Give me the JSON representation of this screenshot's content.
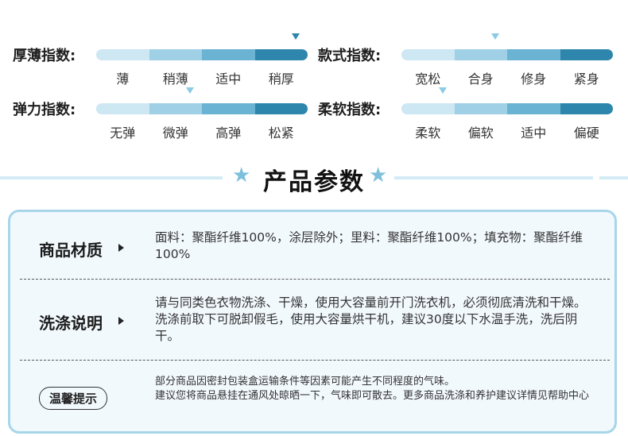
{
  "indices": {
    "thickness": {
      "label": "厚薄指数:",
      "options": [
        "薄",
        "稍薄",
        "适中",
        "稍厚"
      ],
      "selected_index": 3
    },
    "style": {
      "label": "款式指数:",
      "options": [
        "宽松",
        "合身",
        "修身",
        "紧身"
      ],
      "selected_index": 1
    },
    "elasticity": {
      "label": "弹力指数:",
      "options": [
        "无弹",
        "微弹",
        "高弹",
        "松紧"
      ],
      "selected_index": 1
    },
    "softness": {
      "label": "柔软指数:",
      "options": [
        "柔软",
        "偏软",
        "适中",
        "偏硬"
      ],
      "selected_index": 0
    }
  },
  "section": {
    "title": "产品参数",
    "star_glyph": "★"
  },
  "params": {
    "material": {
      "title": "商品材质",
      "text": "面料：聚酯纤维100%，涂层除外；里料：聚酯纤维100%；填充物：聚酯纤维100%"
    },
    "washing": {
      "title": "洗涤说明",
      "text": "请与同类色衣物洗涤、干燥，使用大容量前开门洗衣机，必须彻底清洗和干燥。洗涤前取下可脱卸假毛，使用大容量烘干机，建议30度以下水温手洗，洗后阴干。"
    },
    "tips": {
      "title": "温馨提示",
      "line1": "部分商品因密封包装盒运输条件等因素可能产生不同程度的气味。",
      "line2": "建议您将商品悬挂在通风处晾晒一下，气味即可散去。更多商品洗涤和养护建议详情见帮助中心"
    }
  },
  "colors": {
    "accent": "#2f86ad",
    "light_accent": "#a7d6e9",
    "card_bg": "#f2f9fd"
  }
}
